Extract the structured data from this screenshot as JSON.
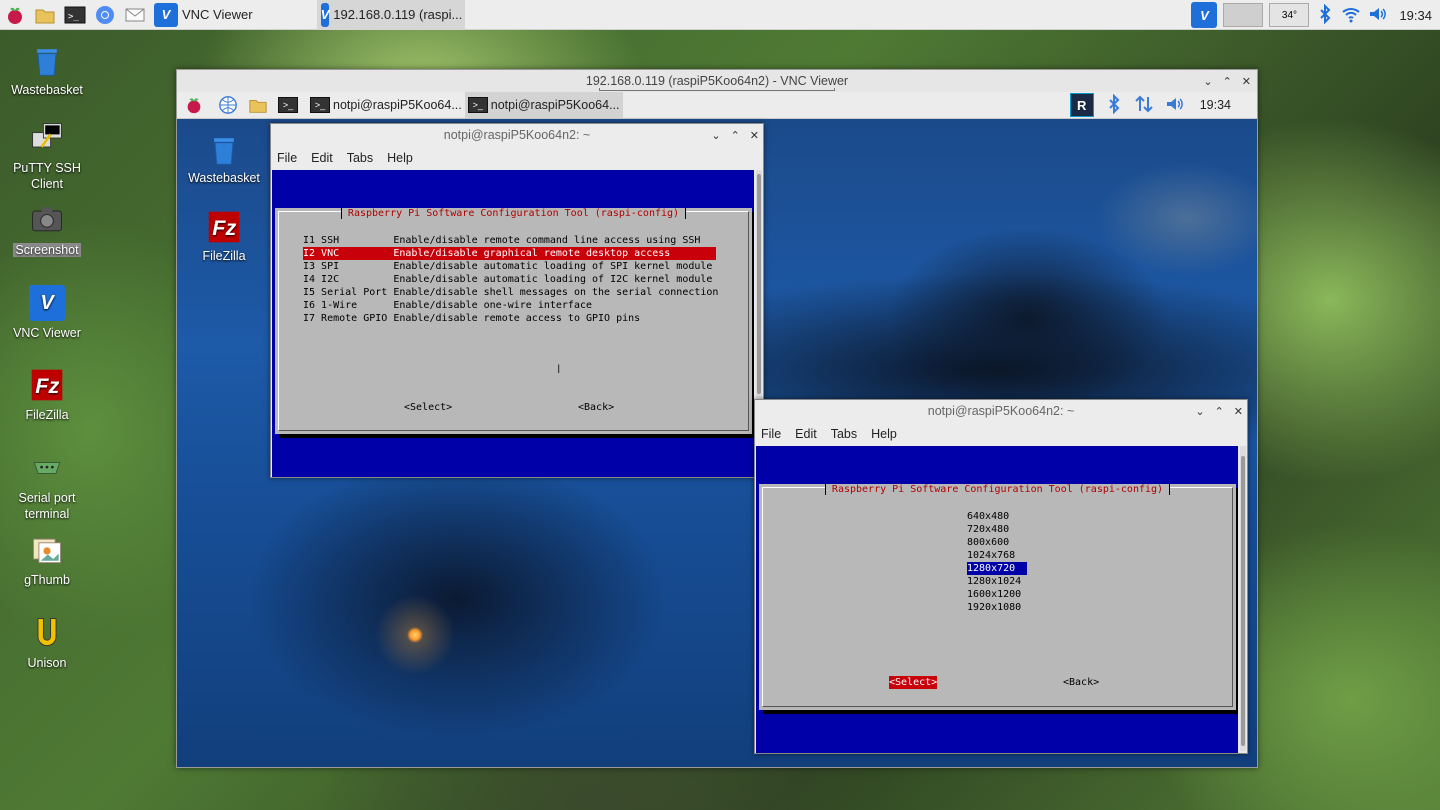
{
  "host_taskbar": {
    "tasks": [
      {
        "label": "VNC Viewer",
        "active": false
      },
      {
        "label": "192.168.0.119 (raspi...",
        "active": true
      }
    ],
    "tray": {
      "temperature": "34°",
      "clock": "19:34"
    }
  },
  "desktop_icons": [
    {
      "label": "Wastebasket",
      "icon": "trash-icon"
    },
    {
      "label": "PuTTY SSH Client",
      "icon": "putty-icon"
    },
    {
      "label": "Screenshot",
      "icon": "camera-icon",
      "selected": true
    },
    {
      "label": "VNC Viewer",
      "icon": "vnc-icon"
    },
    {
      "label": "FileZilla",
      "icon": "filezilla-icon"
    },
    {
      "label": "Serial port terminal",
      "icon": "serial-port-icon"
    },
    {
      "label": "gThumb",
      "icon": "gthumb-icon"
    },
    {
      "label": "Unison",
      "icon": "unison-icon"
    }
  ],
  "vnc_window": {
    "title": "192.168.0.119 (raspiP5Koo64n2) - VNC Viewer",
    "remote_panel": {
      "tasks": [
        {
          "label": "notpi@raspiP5Koo64...",
          "active": false
        },
        {
          "label": "notpi@raspiP5Koo64...",
          "active": true
        }
      ],
      "clock": "19:34"
    },
    "remote_desktop_icons": [
      {
        "label": "Wastebasket",
        "icon": "trash-icon"
      },
      {
        "label": "FileZilla",
        "icon": "filezilla-icon"
      }
    ]
  },
  "terminal1": {
    "title": "notpi@raspiP5Koo64n2: ~",
    "menu": [
      "File",
      "Edit",
      "Tabs",
      "Help"
    ],
    "dialog_title": "Raspberry Pi Software Configuration Tool (raspi-config)",
    "items": [
      {
        "code": "I1 SSH        ",
        "desc": "Enable/disable remote command line access using SSH"
      },
      {
        "code": "I2 VNC        ",
        "desc": "Enable/disable graphical remote desktop access",
        "selected": true
      },
      {
        "code": "I3 SPI        ",
        "desc": "Enable/disable automatic loading of SPI kernel module"
      },
      {
        "code": "I4 I2C        ",
        "desc": "Enable/disable automatic loading of I2C kernel module"
      },
      {
        "code": "I5 Serial Port",
        "desc": "Enable/disable shell messages on the serial connection"
      },
      {
        "code": "I6 1-Wire     ",
        "desc": "Enable/disable one-wire interface"
      },
      {
        "code": "I7 Remote GPIO",
        "desc": "Enable/disable remote access to GPIO pins"
      }
    ],
    "select_button": "<Select>",
    "back_button": "<Back>"
  },
  "terminal2": {
    "title": "notpi@raspiP5Koo64n2: ~",
    "menu": [
      "File",
      "Edit",
      "Tabs",
      "Help"
    ],
    "dialog_title": "Raspberry Pi Software Configuration Tool (raspi-config)",
    "resolutions": [
      "640x480",
      "720x480",
      "800x600",
      "1024x768",
      "1280x720",
      "1280x1024",
      "1600x1200",
      "1920x1080"
    ],
    "selected_resolution": "1280x720",
    "select_button": "<Select>",
    "back_button": "<Back>"
  },
  "colors": {
    "whiptail_blue": "#0000a8",
    "selection_red": "#c8000a",
    "dialog_gray": "#b8b8b8",
    "vnc_blue": "#1e6fd9"
  }
}
